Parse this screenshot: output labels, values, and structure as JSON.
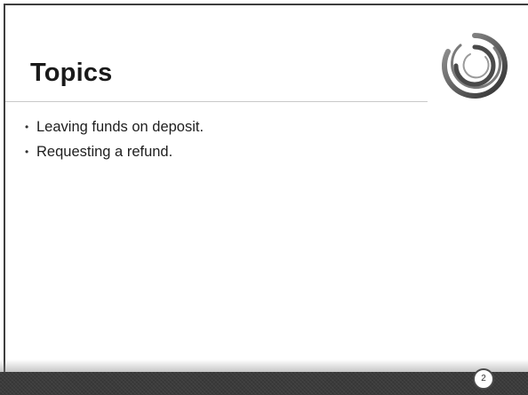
{
  "slide": {
    "title": "Topics",
    "bullets": [
      "Leaving funds on deposit.",
      "Requesting a refund."
    ],
    "bullet_glyph": "•",
    "page_number": "2"
  },
  "colors": {
    "footer": "#3b3b3b",
    "frame": "#3e3e3e",
    "logo_ring": "#808080"
  },
  "icons": {
    "logo": "concentric-rings-logo"
  }
}
